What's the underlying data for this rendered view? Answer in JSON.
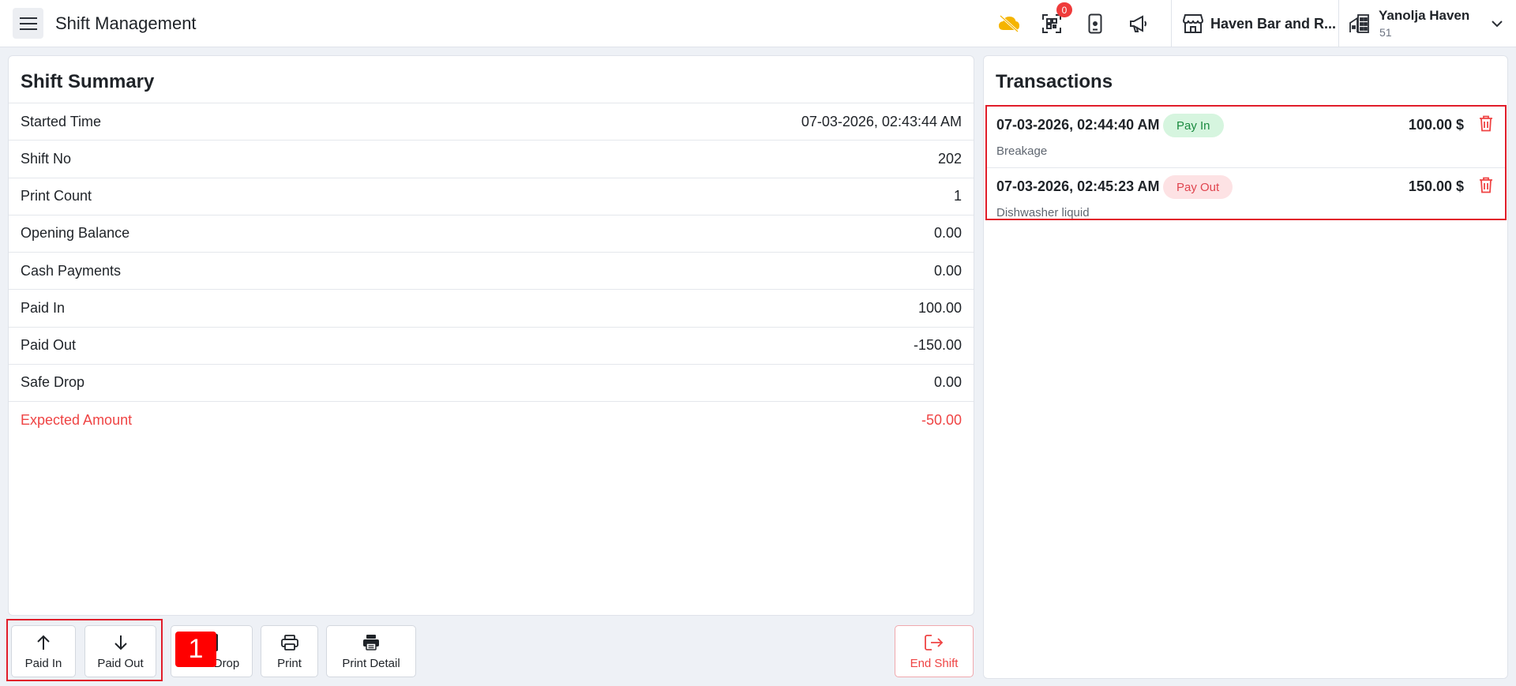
{
  "header": {
    "title": "Shift Management",
    "notification_count": "0",
    "store_name": "Haven Bar and R...",
    "user_name": "Yanolja Haven",
    "user_sub": "51"
  },
  "summary": {
    "title": "Shift Summary",
    "rows": [
      {
        "label": "Started Time",
        "value": "07-03-2026, 02:43:44 AM"
      },
      {
        "label": "Shift No",
        "value": "202"
      },
      {
        "label": "Print Count",
        "value": "1"
      },
      {
        "label": "Opening Balance",
        "value": "0.00"
      },
      {
        "label": "Cash Payments",
        "value": "0.00"
      },
      {
        "label": "Paid In",
        "value": "100.00"
      },
      {
        "label": "Paid Out",
        "value": "-150.00"
      },
      {
        "label": "Safe Drop",
        "value": "0.00"
      },
      {
        "label": "Expected Amount",
        "value": "-50.00"
      }
    ]
  },
  "transactions": {
    "title": "Transactions",
    "items": [
      {
        "time": "07-03-2026, 02:44:40 AM",
        "type": "Pay In",
        "amount": "100.00 $",
        "description": "Breakage"
      },
      {
        "time": "07-03-2026, 02:45:23 AM",
        "type": "Pay Out",
        "amount": "150.00 $",
        "description": "Dishwasher liquid"
      }
    ]
  },
  "actions": {
    "paid_in": "Paid In",
    "paid_out": "Paid Out",
    "safe_drop": "Drop",
    "print": "Print",
    "print_detail": "Print Detail",
    "end_shift": "End Shift"
  },
  "marker_label": "1",
  "colors": {
    "accent_red": "#ef4444",
    "highlight_border": "#e11d2a",
    "pay_in_bg": "#d6f5df",
    "pay_out_bg": "#fde2e4",
    "cloud_icon": "#f5b400"
  }
}
